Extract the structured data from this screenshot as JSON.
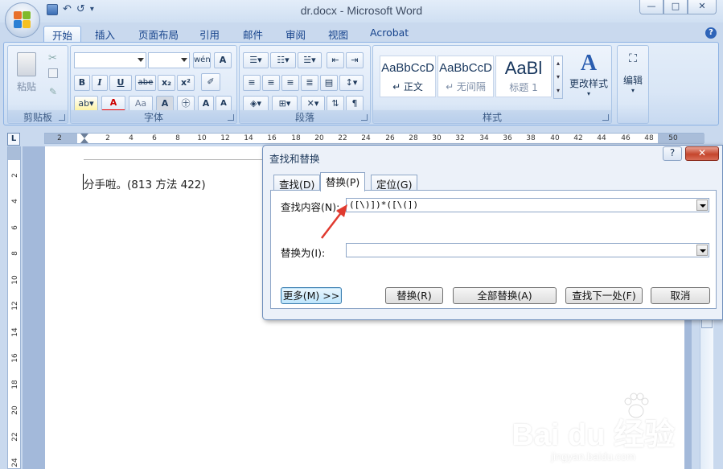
{
  "titlebar": {
    "title": "dr.docx - Microsoft Word",
    "qat_save": "save-icon",
    "qat_undo": "↶",
    "qat_redo": "↺",
    "qat_more": "▾",
    "minimize": "—",
    "maximize": "□",
    "close": "✕"
  },
  "tabs": [
    "开始",
    "插入",
    "页面布局",
    "引用",
    "邮件",
    "审阅",
    "视图",
    "Acrobat"
  ],
  "ribbon": {
    "clipboard": {
      "paste": "粘贴",
      "label": "剪贴板"
    },
    "font": {
      "label": "字体",
      "font_name": "",
      "font_size": "",
      "bold": "B",
      "italic": "I",
      "underline": "U",
      "strike": "abe",
      "subscript": "x₂",
      "superscript": "x²",
      "font_color": "A",
      "case": "Aa",
      "grow": "A",
      "shrink": "A"
    },
    "paragraph": {
      "label": "段落"
    },
    "styles": {
      "label": "样式",
      "items": [
        {
          "sample": "AaBbCcD",
          "name": "↵ 正文"
        },
        {
          "sample": "AaBbCcD",
          "name": "↵ 无间隔"
        },
        {
          "sample": "AaBl",
          "name": "标题 1"
        }
      ],
      "change_styles": "更改样式"
    },
    "editing": {
      "label": "编辑"
    }
  },
  "ruler": {
    "corner": "L",
    "ticks": [
      "2",
      "2",
      "4",
      "6",
      "8",
      "10",
      "12",
      "14",
      "16",
      "18",
      "20",
      "22",
      "24",
      "26",
      "28",
      "30",
      "32",
      "34",
      "36",
      "38",
      "40",
      "42",
      "44",
      "46",
      "48",
      "50"
    ],
    "vticks": [
      "2",
      "4",
      "6",
      "8",
      "10",
      "12",
      "14",
      "16",
      "18",
      "20",
      "22",
      "24"
    ]
  },
  "document": {
    "text": "分手啦。(813 方法 422)"
  },
  "dialog": {
    "title": "查找和替换",
    "help": "?",
    "close": "✕",
    "tabs": [
      "查找(D)",
      "替换(P)",
      "定位(G)"
    ],
    "find_label": "查找内容(N):",
    "find_value": "([\\)])*([\\(])",
    "replace_label": "替换为(I):",
    "replace_value": "",
    "buttons": {
      "more": "更多(M) >>",
      "replace": "替换(R)",
      "replace_all": "全部替换(A)",
      "find_next": "查找下一处(F)",
      "cancel": "取消"
    }
  },
  "watermark": {
    "brand": "Bai du 经验",
    "url": "jingyan.baidu.com"
  },
  "colors": {
    "accent": "#15428b",
    "ribbon_bg": "#dce8f7",
    "arrow": "#e03a2f"
  }
}
